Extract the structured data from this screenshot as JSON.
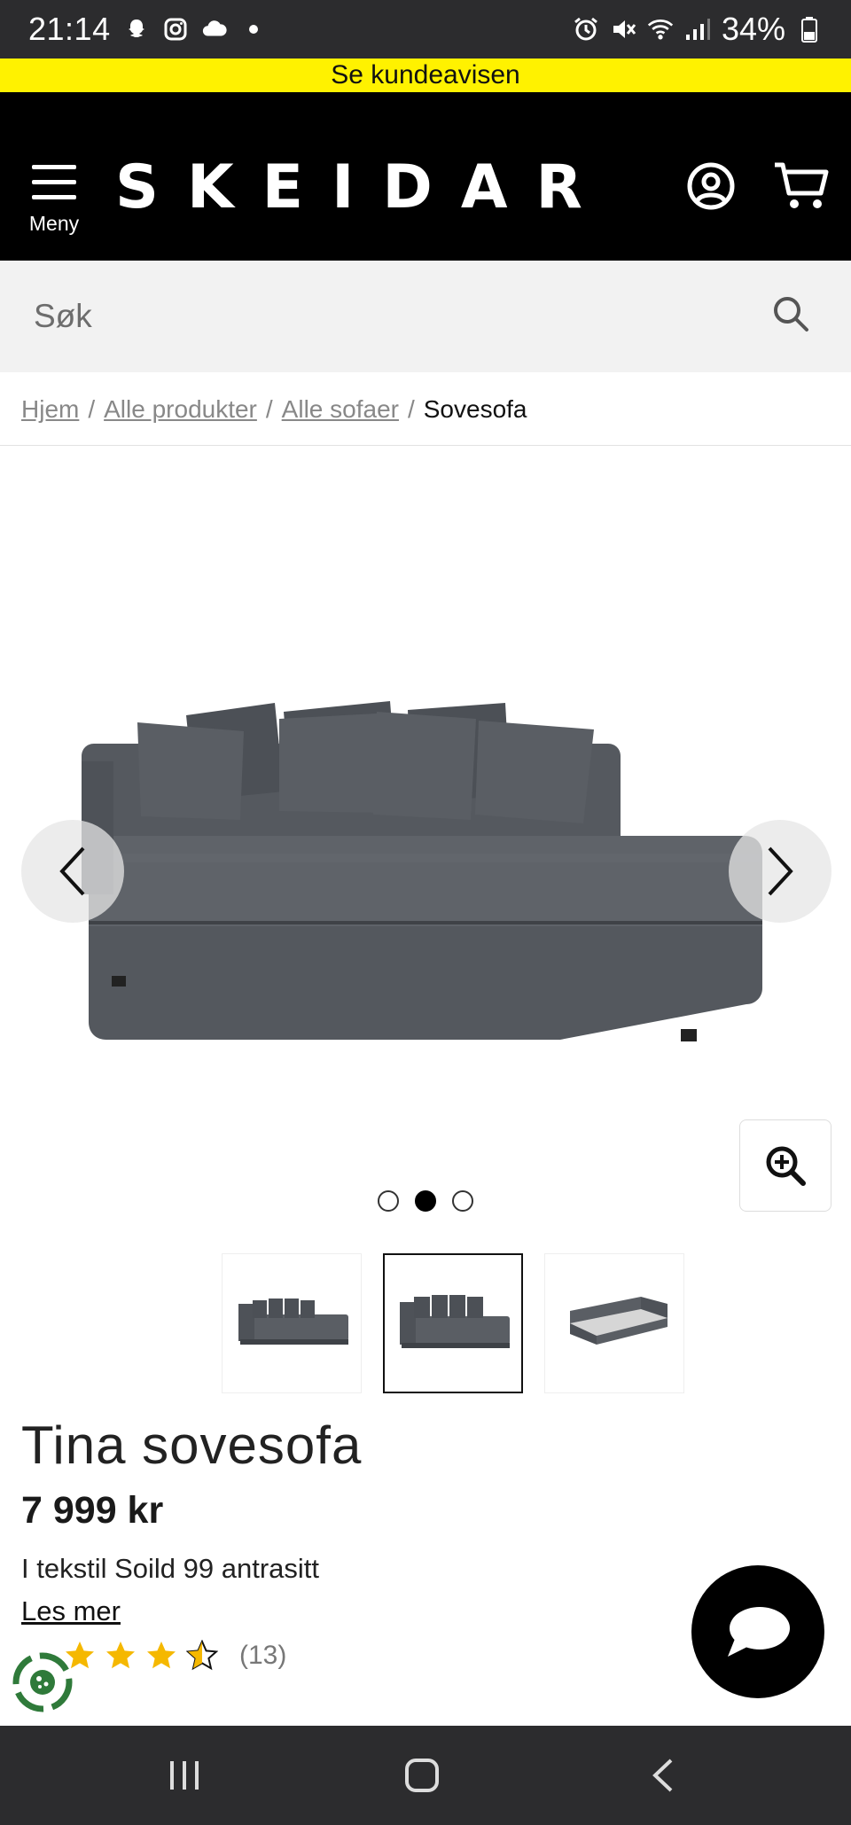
{
  "status_bar": {
    "time": "21:14",
    "battery": "34%",
    "left_icons": [
      "snapchat-icon",
      "instagram-icon",
      "cloud-icon",
      "dot-icon"
    ],
    "right_icons": [
      "alarm-icon",
      "mute-icon",
      "wifi-icon",
      "signal-icon",
      "battery-icon"
    ]
  },
  "promo": {
    "text": "Se kundeavisen"
  },
  "header": {
    "menu_label": "Meny",
    "logo": "SKEIDAR",
    "colors": {
      "background": "#000000",
      "accent": "#fff200"
    }
  },
  "search": {
    "placeholder": "Søk"
  },
  "breadcrumb": {
    "items": [
      "Hjem",
      "Alle produkter",
      "Alle sofaer"
    ],
    "separator": "/",
    "current": "Sovesofa"
  },
  "gallery": {
    "image_count": 3,
    "active_index": 2,
    "thumbnails": [
      "sofa-front-thumb",
      "sofa-pillows-thumb",
      "sofa-bed-open-thumb"
    ]
  },
  "product": {
    "title": "Tina sovesofa",
    "price": "7 999 kr",
    "subtitle": "I tekstil Soild 99 antrasitt",
    "read_more": "Les mer",
    "rating_value": 3.5,
    "rating_max": 5,
    "rating_count": "(13)"
  }
}
